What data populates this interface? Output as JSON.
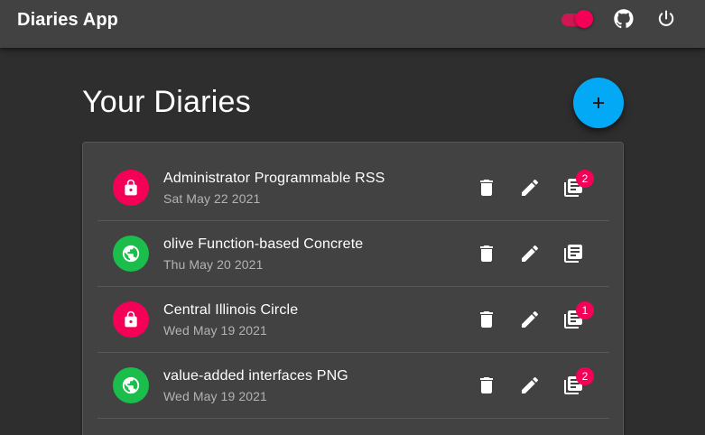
{
  "appbar": {
    "title": "Diaries App",
    "theme_toggle_on": true
  },
  "page": {
    "title": "Your Diaries",
    "add_button_label": "+"
  },
  "diaries": [
    {
      "title": "Administrator Programmable RSS",
      "date": "Sat May 22 2021",
      "visibility": "private",
      "entries_badge": "2"
    },
    {
      "title": "olive Function-based Concrete",
      "date": "Thu May 20 2021",
      "visibility": "public",
      "entries_badge": ""
    },
    {
      "title": "Central Illinois Circle",
      "date": "Wed May 19 2021",
      "visibility": "private",
      "entries_badge": "1"
    },
    {
      "title": "value-added interfaces PNG",
      "date": "Wed May 19 2021",
      "visibility": "public",
      "entries_badge": "2"
    }
  ],
  "icons": {
    "private": "lock-icon",
    "public": "globe-icon",
    "delete": "trash-icon",
    "edit": "pencil-icon",
    "entries": "library-books-icon"
  },
  "colors": {
    "accent_pink": "#f50057",
    "fab_blue": "#03a9f4",
    "public_green": "#1bbd4b",
    "appbar": "#424242",
    "background": "#2e2e2e"
  }
}
